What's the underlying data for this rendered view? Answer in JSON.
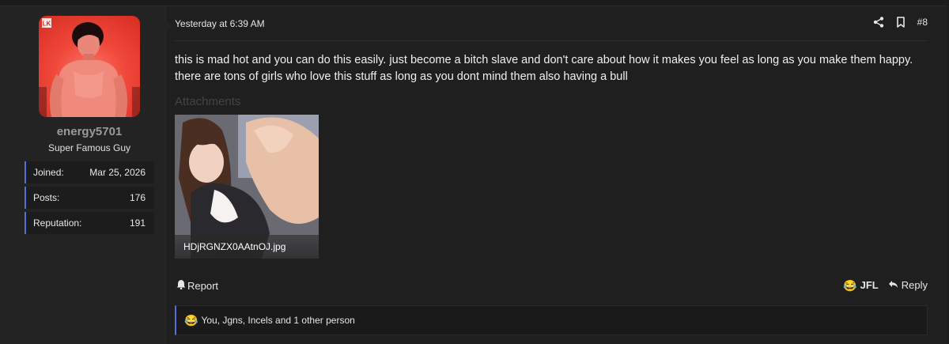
{
  "user": {
    "username": "energy5701",
    "title": "Super Famous Guy",
    "stats": [
      {
        "label": "Joined:",
        "value": "Mar 25, 2026"
      },
      {
        "label": "Posts:",
        "value": "176"
      },
      {
        "label": "Reputation:",
        "value": "191"
      }
    ],
    "avatar_logo": "LK"
  },
  "post": {
    "date": "Yesterday at 6:39 AM",
    "number": "#8",
    "message": "this is mad hot and you can do this easily. just become a bitch slave and don't care about how it makes you feel as long as you make them happy. there are tons of girls who love this stuff as long as you dont mind them also having a bull",
    "attachments_label": "Attachments",
    "attachment": {
      "filename": "HDjRGNZX0AAtnOJ.jpg"
    }
  },
  "actions": {
    "report_label": "Report",
    "reaction_label": "JFL",
    "reply_label": "Reply"
  },
  "reactions": {
    "emoji": "😂",
    "summary": "You, Jgns, Incels and 1 other person"
  },
  "icons": {
    "share": "share-icon",
    "bookmark": "bookmark-icon",
    "report": "bell-icon",
    "reply": "reply-icon",
    "reaction": "laughing-crying-emoji-icon"
  },
  "colors": {
    "accent": "#5a6ed8",
    "background": "#1f1f1f",
    "panel": "#232323"
  }
}
